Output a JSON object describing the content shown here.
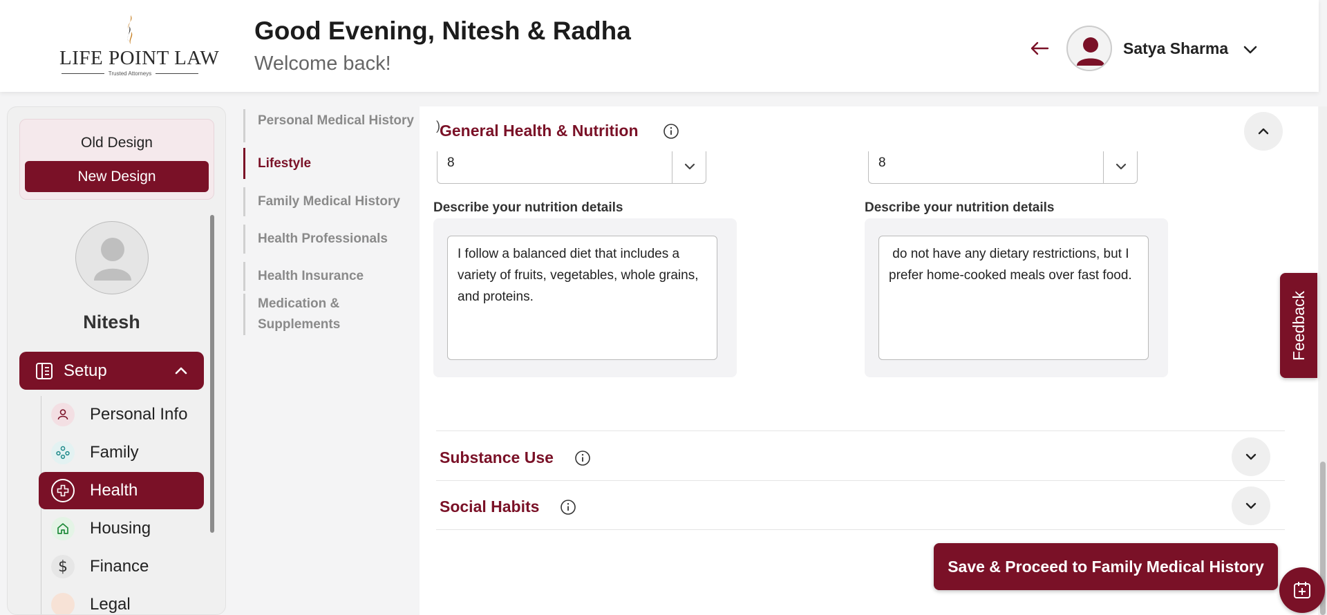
{
  "header": {
    "logo_name": "LIFE POINT LAW",
    "logo_tagline": "Trusted Attorneys",
    "greeting": "Good Evening, Nitesh & Radha",
    "subtitle": "Welcome back!",
    "user_name": "Satya Sharma"
  },
  "sidebar": {
    "old_design": "Old Design",
    "new_design": "New Design",
    "profile_name": "Nitesh",
    "setup_label": "Setup",
    "items": [
      {
        "label": "Personal Info",
        "icon": "person-icon",
        "active": false
      },
      {
        "label": "Family",
        "icon": "family-icon",
        "active": false
      },
      {
        "label": "Health",
        "icon": "health-plus-icon",
        "active": true
      },
      {
        "label": "Housing",
        "icon": "home-icon",
        "active": false
      },
      {
        "label": "Finance",
        "icon": "dollar-icon",
        "active": false
      },
      {
        "label": "Legal",
        "icon": "legal-icon",
        "active": false
      }
    ]
  },
  "subnav": {
    "items": [
      {
        "label": "Personal Medical History",
        "active": false
      },
      {
        "label": "Lifestyle",
        "active": true
      },
      {
        "label": "Family Medical History",
        "active": false
      },
      {
        "label": "Health Professionals",
        "active": false
      },
      {
        "label": "Health Insurance",
        "active": false
      },
      {
        "label": "Medication & Supplements",
        "active": false
      }
    ]
  },
  "main": {
    "stray_char": ")",
    "general": {
      "title": "General Health & Nutrition",
      "left_select_value": "8",
      "right_select_value": "8",
      "left_label": "Describe your nutrition details",
      "right_label": "Describe your nutrition details",
      "left_text": "I follow a balanced diet that includes a variety of fruits, vegetables, whole grains, and proteins.",
      "right_text": " do not have any dietary restrictions, but I prefer home-cooked meals over fast food."
    },
    "substance_title": "Substance Use",
    "social_title": "Social Habits",
    "save_button": "Save & Proceed to Family Medical History"
  },
  "feedback_label": "Feedback",
  "colors": {
    "accent": "#7a1127",
    "background": "#f4f4f5"
  }
}
